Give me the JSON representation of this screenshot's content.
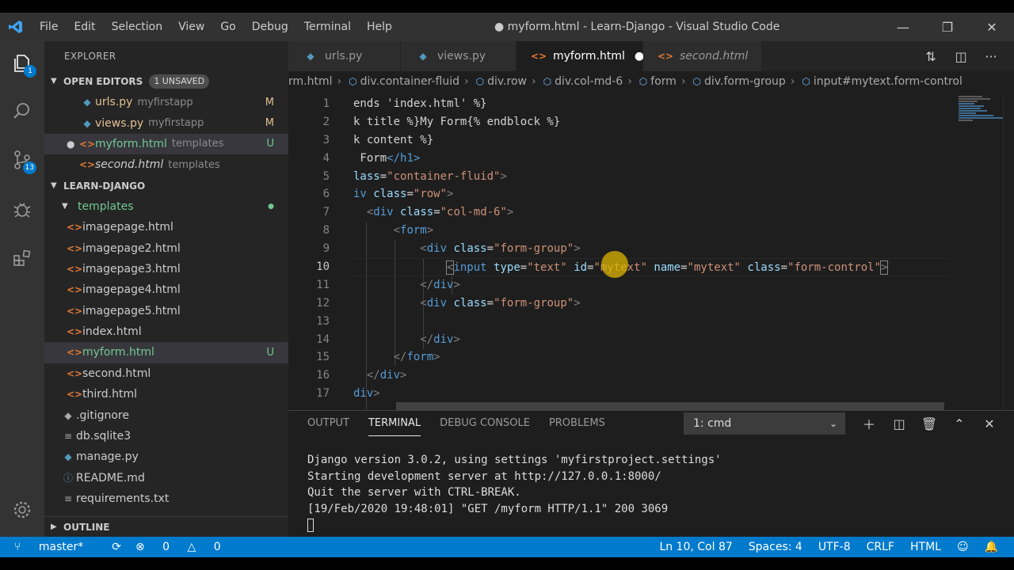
{
  "window": {
    "title": "● myform.html - Learn-Django - Visual Studio Code",
    "menu": [
      "File",
      "Edit",
      "Selection",
      "View",
      "Go",
      "Debug",
      "Terminal",
      "Help"
    ]
  },
  "activity": {
    "explorer_badge": "1",
    "scm_badge": "13"
  },
  "sidebar": {
    "title": "EXPLORER",
    "open_editors": {
      "header": "OPEN EDITORS",
      "unsaved_badge": "1 UNSAVED",
      "items": [
        {
          "name": "urls.py",
          "desc": "myfirstapp",
          "status": "M"
        },
        {
          "name": "views.py",
          "desc": "myfirstapp",
          "status": "M"
        },
        {
          "name": "myform.html",
          "desc": "templates",
          "status": "U"
        },
        {
          "name": "second.html",
          "desc": "templates",
          "status": ""
        }
      ]
    },
    "project": {
      "header": "LEARN-DJANGO",
      "folder": "templates",
      "files": [
        "imagepage.html",
        "imagepage2.html",
        "imagepage3.html",
        "imagepage4.html",
        "imagepage5.html",
        "index.html",
        "myform.html",
        "second.html",
        "third.html"
      ],
      "selected_status": "U",
      "root_files": [
        ".gitignore",
        "db.sqlite3",
        "manage.py",
        "README.md",
        "requirements.txt"
      ]
    },
    "outline_header": "OUTLINE"
  },
  "tabs": [
    {
      "label": "urls.py"
    },
    {
      "label": "views.py"
    },
    {
      "label": "myform.html"
    },
    {
      "label": "second.html"
    }
  ],
  "breadcrumb": [
    "rm.html",
    "div.container-fluid",
    "div.row",
    "div.col-md-6",
    "form",
    "div.form-group",
    "input#mytext.form-control"
  ],
  "editor": {
    "line_numbers": [
      "1",
      "2",
      "3",
      "4",
      "5",
      "6",
      "7",
      "8",
      "9",
      "10",
      "11",
      "12",
      "13",
      "14",
      "15",
      "16",
      "17"
    ],
    "lines": {
      "l1": "ends 'index.html' %}",
      "l2": "k title %}My Form{% endblock %}",
      "l3": "k content %}",
      "l4_text": " Form",
      "l4_close": "</h1>",
      "l5_attr": "lass",
      "l5_val": "\"container-fluid\"",
      "l5_end": ">",
      "l6_tag": "iv",
      "l6_attr": "class",
      "l6_val": "\"row\"",
      "l6_end": ">",
      "l7_open": "<",
      "l7_tag": "div",
      "l7_attr": "class",
      "l7_val": "\"col-md-6\"",
      "l7_end": ">",
      "l8_open": "<",
      "l8_tag": "form",
      "l8_end": ">",
      "l9_open": "<",
      "l9_tag": "div",
      "l9_attr": "class",
      "l9_val": "\"form-group\"",
      "l9_end": ">",
      "l10_open": "<",
      "l10_tag": "input",
      "l10_a1": "type",
      "l10_v1": "\"text\"",
      "l10_a2": "id",
      "l10_v2": "\"mytext\"",
      "l10_a3": "name",
      "l10_v3": "\"mytext\"",
      "l10_a4": "class",
      "l10_v4": "\"form-control\"",
      "l10_end": ">",
      "l11_open": "</",
      "l11_tag": "div",
      "l11_end": ">",
      "l12_open": "<",
      "l12_tag": "div",
      "l12_attr": "class",
      "l12_val": "\"form-group\"",
      "l12_end": ">",
      "l14_open": "</",
      "l14_tag": "div",
      "l14_end": ">",
      "l15_open": "</",
      "l15_tag": "form",
      "l15_end": ">",
      "l16_open": "</",
      "l16_tag": "div",
      "l16_end": ">",
      "l17_tag": "div",
      "l17_end": ">"
    }
  },
  "panel": {
    "tabs": [
      "OUTPUT",
      "TERMINAL",
      "DEBUG CONSOLE",
      "PROBLEMS"
    ],
    "terminal_select": "1: cmd",
    "terminal_lines": [
      "Django version 3.0.2, using settings 'myfirstproject.settings'",
      "Starting development server at http://127.0.0.1:8000/",
      "Quit the server with CTRL-BREAK.",
      "[19/Feb/2020 19:48:01] \"GET /myform HTTP/1.1\" 200 3069"
    ]
  },
  "statusbar": {
    "branch": "master*",
    "errors": "0",
    "warnings": "0",
    "position": "Ln 10, Col 87",
    "spaces": "Spaces: 4",
    "encoding": "UTF-8",
    "eol": "CRLF",
    "language": "HTML"
  },
  "colors": {
    "accent": "#007acc",
    "modified": "#e2c08d",
    "untracked": "#73c991"
  }
}
